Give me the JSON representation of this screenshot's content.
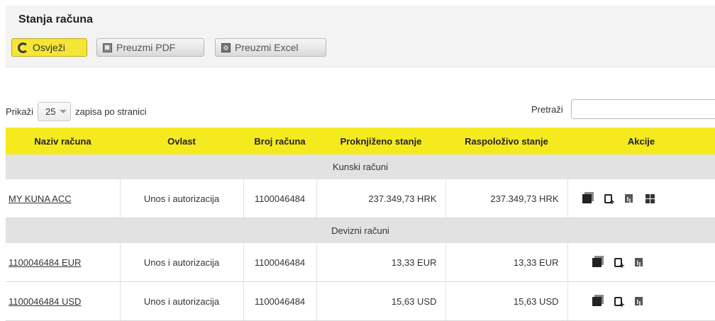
{
  "header": {
    "title": "Stanja računa"
  },
  "toolbar": {
    "refresh_label": "Osvježi",
    "pdf_label": "Preuzmi PDF",
    "excel_label": "Preuzmi Excel"
  },
  "length": {
    "prefix": "Prikaži",
    "value": "25",
    "suffix": "zapisa po stranici"
  },
  "search": {
    "label": "Pretraži",
    "value": ""
  },
  "table": {
    "columns": [
      "Naziv računa",
      "Ovlast",
      "Broj računa",
      "Proknjiženo stanje",
      "Raspoloživo stanje",
      "Akcije"
    ],
    "groups": [
      {
        "title": "Kunski računi",
        "rows": [
          {
            "name": "MY KUNA ACC",
            "authority": "Unos i autorizacija",
            "number": "1100046484",
            "booked": "237.349,73 HRK",
            "available": "237.349,73 HRK",
            "actions": [
              "statement-icon",
              "new-payment-icon",
              "report-icon",
              "grid-icon"
            ]
          }
        ]
      },
      {
        "title": "Devizni računi",
        "rows": [
          {
            "name": "1100046484 EUR",
            "authority": "Unos i autorizacija",
            "number": "1100046484",
            "booked": "13,33 EUR",
            "available": "13,33 EUR",
            "actions": [
              "statement-icon",
              "new-payment-icon",
              "report-icon"
            ]
          },
          {
            "name": "1100046484 USD",
            "authority": "Unos i autorizacija",
            "number": "1100046484",
            "booked": "15,63 USD",
            "available": "15,63 USD",
            "actions": [
              "statement-icon",
              "new-payment-icon",
              "report-icon"
            ]
          }
        ]
      }
    ]
  },
  "colors": {
    "accent": "#f5ea1e",
    "group_bg": "#e2e2e2",
    "panel_bg": "#f3f3f3"
  }
}
